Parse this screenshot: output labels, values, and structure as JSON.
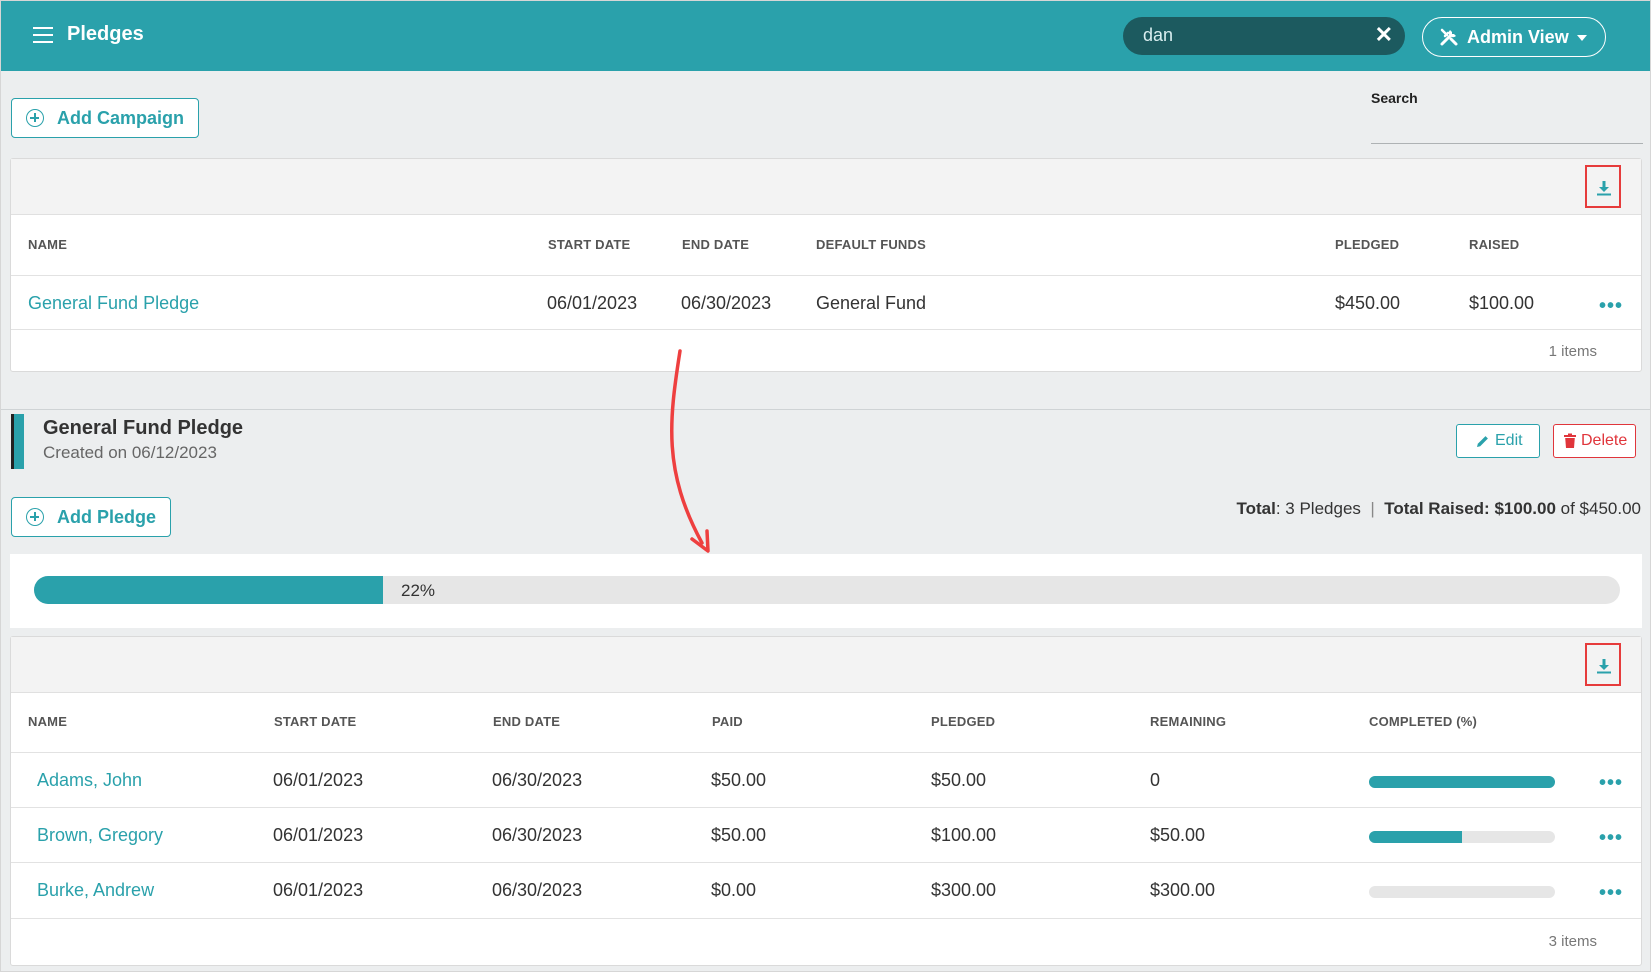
{
  "header": {
    "title": "Pledges",
    "search_value": "dan",
    "admin_label": "Admin View"
  },
  "toolbar": {
    "add_campaign_label": "Add Campaign",
    "search_label": "Search"
  },
  "campaigns_table": {
    "columns": [
      "NAME",
      "START DATE",
      "END DATE",
      "DEFAULT FUNDS",
      "PLEDGED",
      "RAISED"
    ],
    "rows": [
      {
        "name": "General Fund Pledge",
        "start": "06/01/2023",
        "end": "06/30/2023",
        "funds": "General Fund",
        "pledged": "$450.00",
        "raised": "$100.00"
      }
    ],
    "footer": "1 items"
  },
  "detail": {
    "title": "General Fund Pledge",
    "created": "Created on 06/12/2023",
    "edit_label": "Edit",
    "delete_label": "Delete",
    "add_pledge_label": "Add Pledge",
    "total_label": "Total",
    "total_value": ": 3 Pledges",
    "separator": "|",
    "raised_label": "Total Raised:",
    "raised_value": "$100.00",
    "of_text": "of $450.00",
    "progress_percent": 22,
    "progress_text": "22%"
  },
  "pledges_table": {
    "columns": [
      "NAME",
      "START DATE",
      "END DATE",
      "PAID",
      "PLEDGED",
      "REMAINING",
      "COMPLETED (%)"
    ],
    "rows": [
      {
        "name": "Adams, John",
        "start": "06/01/2023",
        "end": "06/30/2023",
        "paid": "$50.00",
        "pledged": "$50.00",
        "remaining": "0",
        "completed": 100
      },
      {
        "name": "Brown, Gregory",
        "start": "06/01/2023",
        "end": "06/30/2023",
        "paid": "$50.00",
        "pledged": "$100.00",
        "remaining": "$50.00",
        "completed": 50
      },
      {
        "name": "Burke, Andrew",
        "start": "06/01/2023",
        "end": "06/30/2023",
        "paid": "$0.00",
        "pledged": "$300.00",
        "remaining": "$300.00",
        "completed": 0
      }
    ],
    "footer": "3 items"
  },
  "colors": {
    "accent": "#2aa1ab",
    "header_bg": "#2aa1ab",
    "highlight_box": "#e63b3b",
    "annotation_arrow": "#ee3f3f",
    "delete": "#e0353b"
  },
  "icons": [
    "menu-icon",
    "close-icon",
    "tools-icon",
    "caret-down-icon",
    "add-circle-icon",
    "download-icon",
    "more-icon",
    "pencil-icon",
    "trash-icon"
  ]
}
